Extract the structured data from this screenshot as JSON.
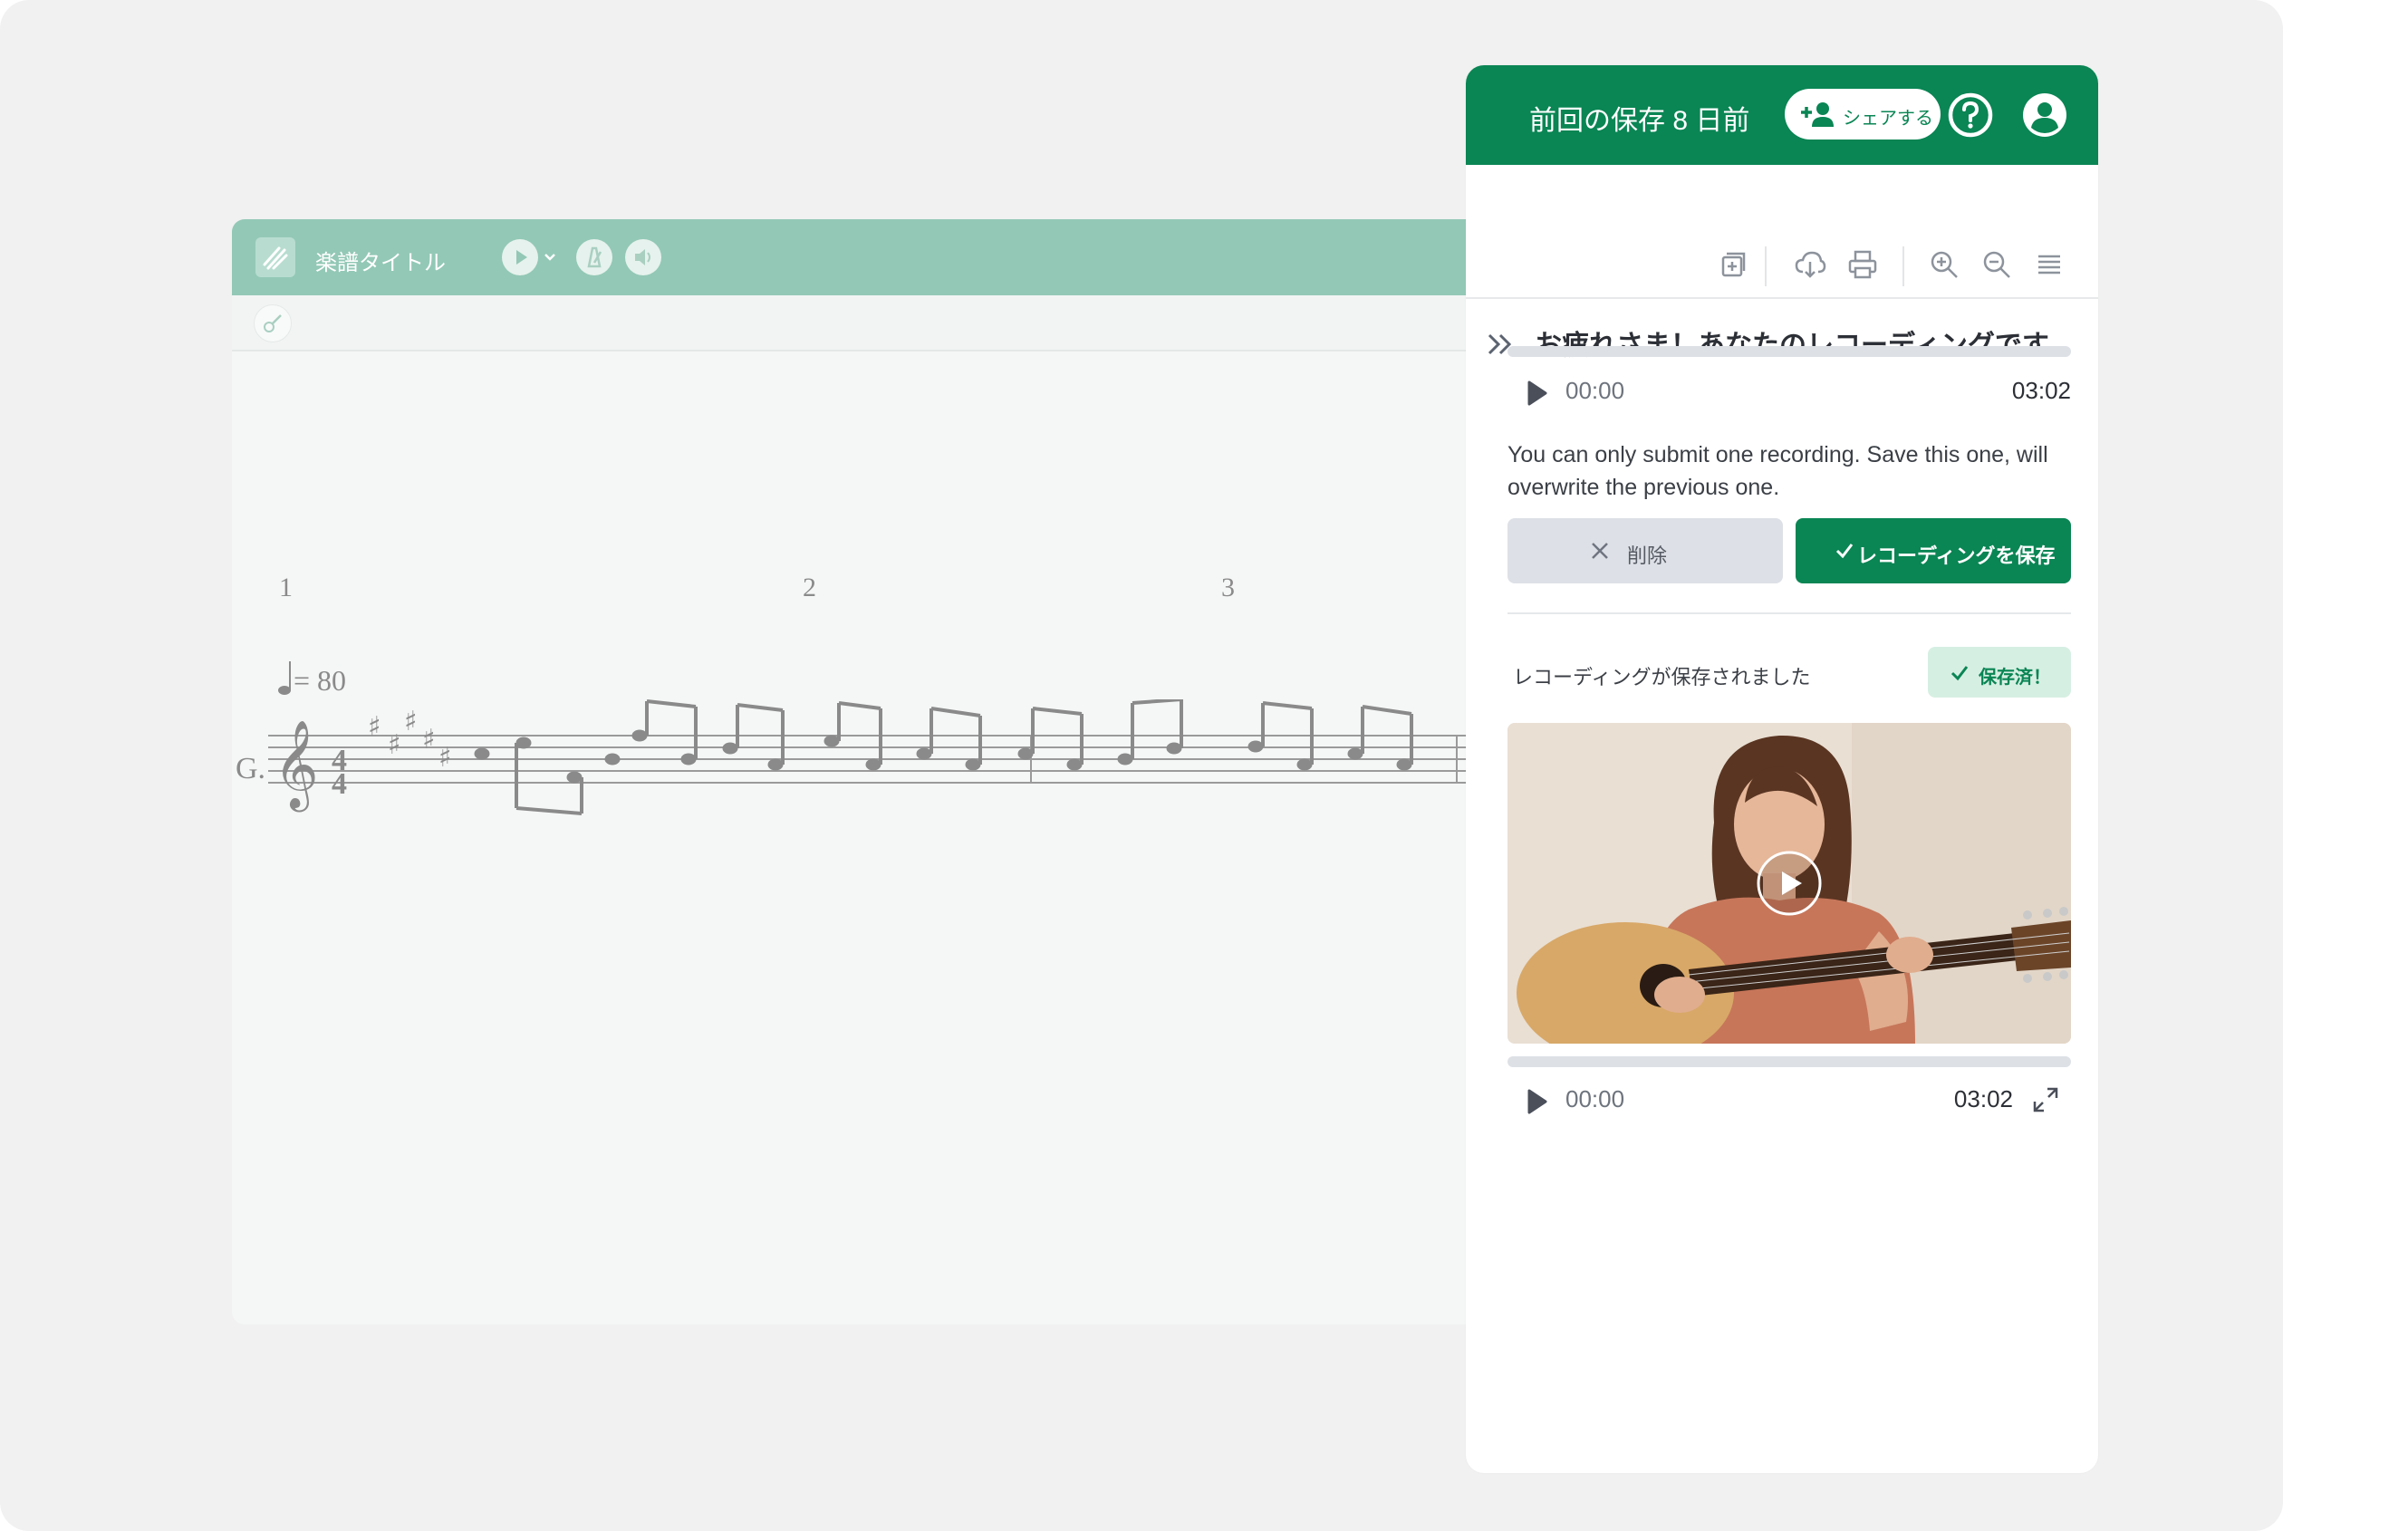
{
  "score_editor": {
    "title": "楽譜タイトル",
    "measure_numbers": [
      "1",
      "2",
      "3"
    ],
    "tempo": "= 80",
    "instrument": "G.",
    "icons": [
      "logo-icon",
      "play-icon",
      "chevron-down-icon",
      "metronome-icon",
      "speaker-icon",
      "guitar-icon"
    ]
  },
  "panel": {
    "saved_ago": "前回の保存 8 日前",
    "share_label": "シェアする",
    "heading": "お疲れさま！あなたのレコーディングです",
    "audio": {
      "current": "00:00",
      "duration": "03:02"
    },
    "notice": "You can only submit one recording. Save this one, will overwrite the previous one.",
    "delete_label": "削除",
    "save_label": "レコーディングを保存",
    "saved_message": "レコーディングが保存されました",
    "saved_badge": "保存済！",
    "video": {
      "current": "00:00",
      "duration": "03:02"
    },
    "toolbar_icons": [
      "duplicate-icon",
      "cloud-download-icon",
      "print-icon",
      "zoom-in-icon",
      "zoom-out-icon",
      "menu-icon"
    ],
    "colors": {
      "primary": "#0a8554",
      "header_soft": "#93c8b6",
      "badge_bg": "#d6efe3"
    }
  }
}
